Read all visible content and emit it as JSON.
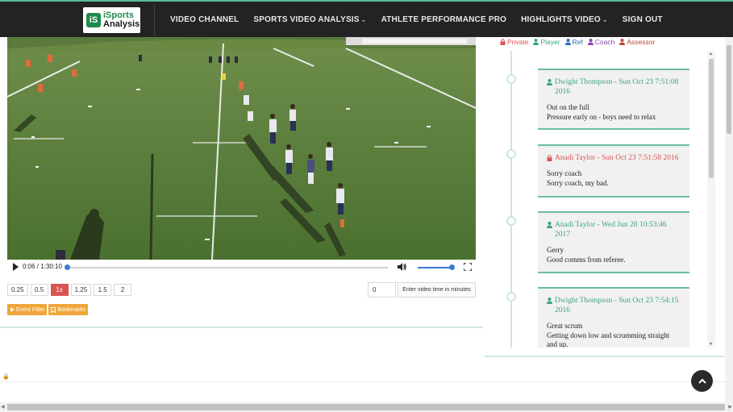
{
  "nav": {
    "logo": {
      "mark": "iS",
      "line1": "iSports",
      "line2": "Analysis"
    },
    "items": [
      {
        "label": "VIDEO CHANNEL",
        "dropdown": false
      },
      {
        "label": "SPORTS VIDEO ANALYSIS",
        "dropdown": true
      },
      {
        "label": "ATHLETE PERFORMANCE PRO",
        "dropdown": false
      },
      {
        "label": "HIGHLIGHTS VIDEO",
        "dropdown": true
      },
      {
        "label": "SIGN OUT",
        "dropdown": false
      }
    ]
  },
  "player": {
    "time": "0:06 / 1:30:10",
    "progress_fraction": 0.001,
    "volume_fraction": 1.0
  },
  "speeds": {
    "options": [
      "0.25",
      "0.5",
      "1x",
      "1.25",
      "1.5",
      "2"
    ],
    "active": "1x"
  },
  "time_jump": {
    "input_value": "0",
    "button_label": "Enter video time in minutes"
  },
  "filters": {
    "event_filter": "Event Filter",
    "bookmarks": "Bookmarks"
  },
  "legend": [
    {
      "label": "Private",
      "color": "#d9534f"
    },
    {
      "label": "Player",
      "color": "#38a57c"
    },
    {
      "label": "Ref",
      "color": "#2f6db5"
    },
    {
      "label": "Coach",
      "color": "#8e44ad"
    },
    {
      "label": "Assessor",
      "color": "#b5482f"
    }
  ],
  "comments": [
    {
      "author_line": "Dwight Thompson - Sun Oct 23 7:51:08 2016",
      "color": "#38a57c",
      "lines": [
        "Out on the full",
        "Pressure early on - boys need to relax"
      ]
    },
    {
      "author_line": "Anadi Taylor - Sun Oct 23 7:51:58 2016",
      "color": "#d9534f",
      "lines": [
        "Sorry coach",
        "Sorry coach, my bad."
      ]
    },
    {
      "author_line": "Anadi Taylor - Wed Jun 28 10:53:46 2017",
      "color": "#38a57c",
      "lines": [
        "Gerry",
        "Good comms from referee."
      ]
    },
    {
      "author_line": "Dwight Thompson - Sun Oct 23 7:54:15 2016",
      "color": "#38a57c",
      "lines": [
        "Great scrum",
        "Getting down low and scrumming straight and up."
      ]
    }
  ]
}
